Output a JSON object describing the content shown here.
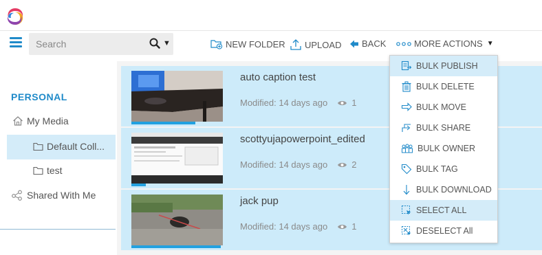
{
  "header": {
    "logo_icon": "brand-swirl-logo"
  },
  "search": {
    "placeholder": "Search",
    "icon": "search-icon"
  },
  "toolbar": {
    "new_folder": "NEW FOLDER",
    "upload": "UPLOAD",
    "back": "BACK",
    "more_actions": "MORE ACTIONS"
  },
  "sidebar": {
    "section_title": "PERSONAL",
    "my_media": "My Media",
    "default_collection": "Default Coll...",
    "test": "test",
    "shared_with_me": "Shared With Me"
  },
  "media": [
    {
      "title": "auto caption test",
      "modified": "Modified: 14 days ago",
      "views": "1",
      "progress": 0.7
    },
    {
      "title": "scottyujapowerpoint_edited",
      "modified": "Modified: 14 days ago",
      "views": "2",
      "progress": 0.16
    },
    {
      "title": "jack pup",
      "modified": "Modified: 14 days ago",
      "views": "1",
      "progress": 0.98
    }
  ],
  "more_actions_menu": [
    {
      "label": "BULK PUBLISH",
      "icon": "publish-icon",
      "highlighted": true
    },
    {
      "label": "BULK DELETE",
      "icon": "trash-icon",
      "highlighted": false
    },
    {
      "label": "BULK MOVE",
      "icon": "move-icon",
      "highlighted": false
    },
    {
      "label": "BULK SHARE",
      "icon": "share-icon",
      "highlighted": false
    },
    {
      "label": "BULK OWNER",
      "icon": "owner-icon",
      "highlighted": false
    },
    {
      "label": "BULK TAG",
      "icon": "tag-icon",
      "highlighted": false
    },
    {
      "label": "BULK DOWNLOAD",
      "icon": "download-icon",
      "highlighted": false
    },
    {
      "label": "SELECT ALL",
      "icon": "select-all-icon",
      "highlighted": true
    },
    {
      "label": "DESELECT All",
      "icon": "deselect-all-icon",
      "highlighted": false
    }
  ],
  "colors": {
    "accent": "#1f8ac9",
    "selection": "#cdebfa",
    "progress": "#22a1e0"
  }
}
